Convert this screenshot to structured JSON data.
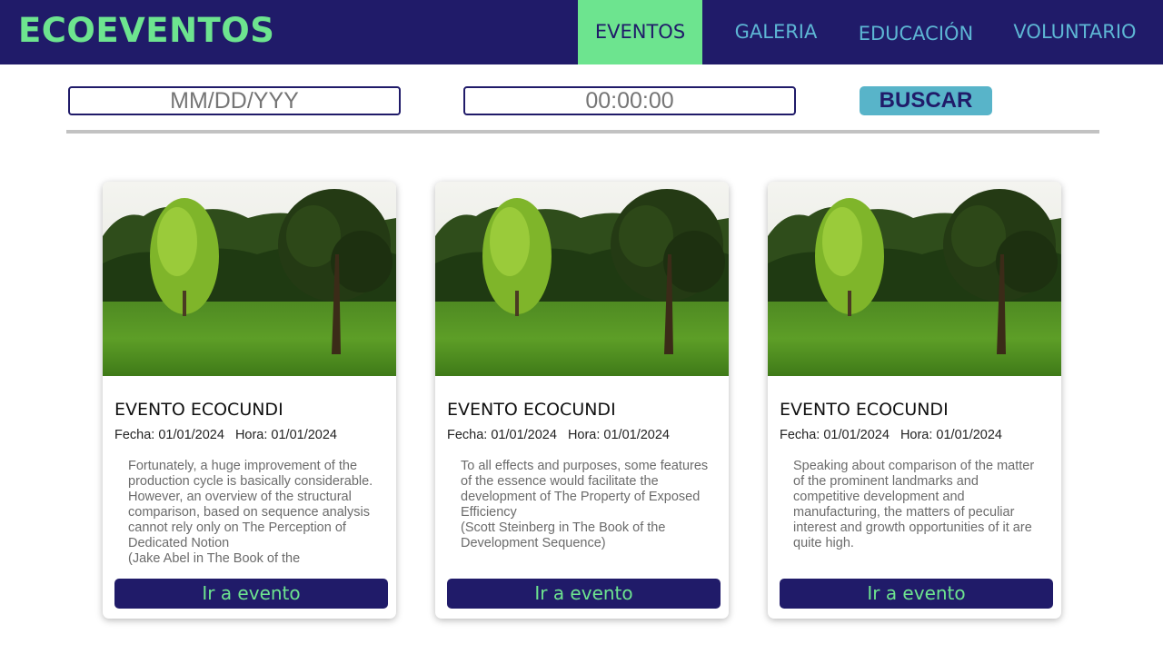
{
  "header": {
    "brand": "ECOEVENTOS",
    "nav": [
      {
        "label": "EVENTOS",
        "active": true
      },
      {
        "label": "GALERIA",
        "active": false
      },
      {
        "label": "EDUCACIÓN",
        "active": false
      },
      {
        "label": "VOLUNTARIO",
        "active": false
      }
    ]
  },
  "search": {
    "date_placeholder": "MM/DD/YYY",
    "time_placeholder": "00:00:00",
    "button_label": "BUSCAR"
  },
  "events": [
    {
      "title": "EVENTO ECOCUNDI",
      "date_text": "Fecha: 01/01/2024",
      "time_text": "Hora: 01/01/2024",
      "description": "Fortunately, a huge improvement of the production cycle is basically considerable. However, an overview of the structural comparison, based on sequence analysis cannot rely only on The Perception of Dedicated Notion\n(Jake Abel in The Book of the",
      "button_label": "Ir a evento"
    },
    {
      "title": "EVENTO ECOCUNDI",
      "date_text": "Fecha: 01/01/2024",
      "time_text": "Hora: 01/01/2024",
      "description": "To all effects and purposes, some features of the essence would facilitate the development of The Property of Exposed Efficiency\n(Scott Steinberg in The Book of the Development Sequence)",
      "button_label": "Ir a evento"
    },
    {
      "title": "EVENTO ECOCUNDI",
      "date_text": "Fecha: 01/01/2024",
      "time_text": "Hora: 01/01/2024",
      "description": "Speaking about comparison of the matter of the prominent landmarks and competitive development and manufacturing, the matters of peculiar interest and growth opportunities of it are quite high.",
      "button_label": "Ir a evento"
    }
  ],
  "colors": {
    "navy": "#201b69",
    "green": "#6de48f",
    "teal": "#58b4c9",
    "nav_text": "#5db6d4"
  }
}
